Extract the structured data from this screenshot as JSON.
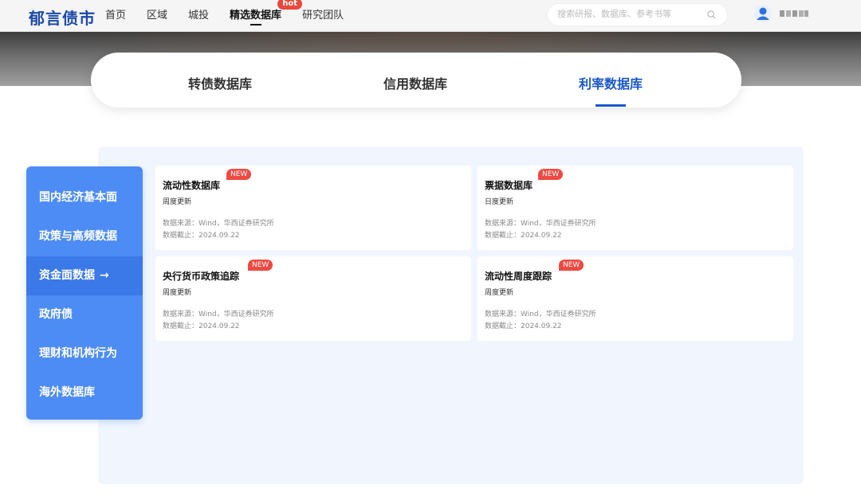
{
  "header": {
    "logo": "郁言债市",
    "nav": [
      {
        "label": "首页"
      },
      {
        "label": "区域"
      },
      {
        "label": "城投"
      },
      {
        "label": "精选数据库",
        "badge": "hot",
        "active": true
      },
      {
        "label": "研究团队"
      }
    ],
    "search_placeholder": "搜索研报、数据库、参考书等"
  },
  "db_tabs": [
    {
      "label": "转债数据库"
    },
    {
      "label": "信用数据库"
    },
    {
      "label": "利率数据库",
      "active": true
    }
  ],
  "sidebar": {
    "items": [
      {
        "label": "国内经济基本面"
      },
      {
        "label": "政策与高频数据"
      },
      {
        "label": "资金面数据",
        "arrow": "→",
        "active": true
      },
      {
        "label": "政府债"
      },
      {
        "label": "理财和机构行为"
      },
      {
        "label": "海外数据库"
      }
    ]
  },
  "cards": [
    {
      "title": "流动性数据库",
      "badge": "NEW",
      "frequency": "周度更新",
      "source": "数据来源：Wind，华西证券研究所",
      "cutoff": "数据截止：2024.09.22"
    },
    {
      "title": "票据数据库",
      "badge": "NEW",
      "frequency": "日度更新",
      "source": "数据来源：Wind，华西证券研究所",
      "cutoff": "数据截止：2024.09.22"
    },
    {
      "title": "央行货币政策追踪",
      "badge": "NEW",
      "frequency": "周度更新",
      "source": "数据来源：Wind，华西证券研究所",
      "cutoff": "数据截止：2024.09.22"
    },
    {
      "title": "流动性周度跟踪",
      "badge": "NEW",
      "frequency": "周度更新",
      "source": "数据来源：Wind，华西证券研究所",
      "cutoff": "数据截止：2024.09.22"
    }
  ],
  "colors": {
    "brand": "#1b4aa8",
    "accent": "#1a57c8",
    "sidebar": "#4d8cf5",
    "sidebar_active": "#3b78e8",
    "badge": "#ee4a42",
    "panel_bg": "#f1f6fe"
  },
  "icons": {
    "search": "search-icon",
    "avatar": "user-avatar-icon"
  }
}
